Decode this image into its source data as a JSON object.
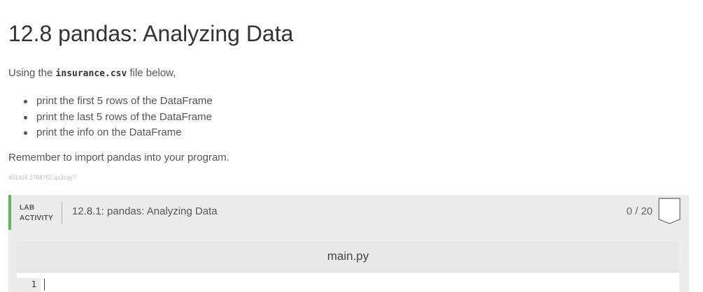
{
  "page": {
    "title": "12.8 pandas: Analyzing Data",
    "intro_prefix": "Using the ",
    "intro_file": "insurance.csv",
    "intro_suffix": " file below,",
    "tasks": [
      "print the first 5 rows of the DataFrame",
      "print the last 5 rows of the DataFrame",
      "print the info on the DataFrame"
    ],
    "reminder": "Remember to import pandas into your program.",
    "tracking_id": "401416.2768752.qx3zqy7"
  },
  "lab": {
    "tag_line1": "LAB",
    "tag_line2": "ACTIVITY",
    "title": "12.8.1: pandas: Analyzing Data",
    "score": "0 / 20",
    "accent_color": "#5cb85c",
    "flag_icon": "bookmark-flag-icon"
  },
  "editor": {
    "filename": "main.py",
    "line_numbers": [
      "1"
    ]
  }
}
